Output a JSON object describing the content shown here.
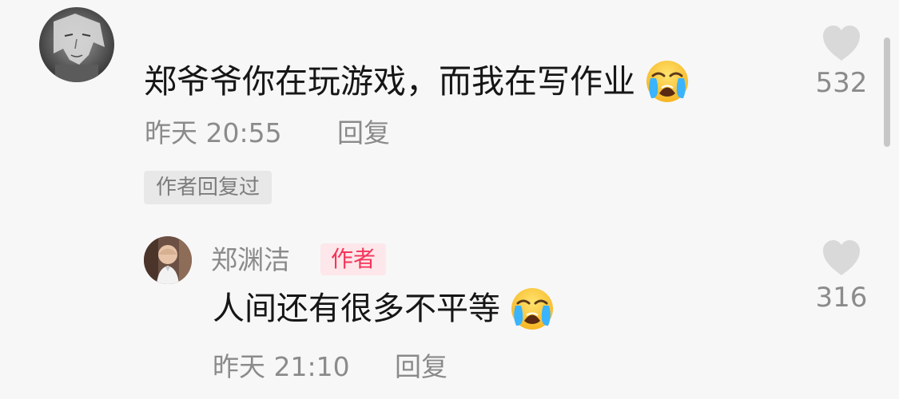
{
  "comments": [
    {
      "text": "郑爷爷你在玩游戏，而我在写作业",
      "emoji": "loudly-crying-face",
      "time": "昨天 20:55",
      "reply_label": "回复",
      "likes": "532",
      "author_replied_label": "作者回复过"
    }
  ],
  "reply": {
    "username": "郑渊洁",
    "author_badge": "作者",
    "text": "人间还有很多不平等",
    "emoji": "loudly-crying-face",
    "time": "昨天 21:10",
    "reply_label": "回复",
    "likes": "316"
  },
  "icons": {
    "like": "heart-icon",
    "emoji": "loudly-crying-face-emoji"
  },
  "colors": {
    "background": "#f7f7f7",
    "text_primary": "#161616",
    "text_secondary": "#8b8b8b",
    "author_badge_text": "#f5345a",
    "author_badge_bg": "#fde7ea",
    "heart": "#d9d9d9"
  }
}
